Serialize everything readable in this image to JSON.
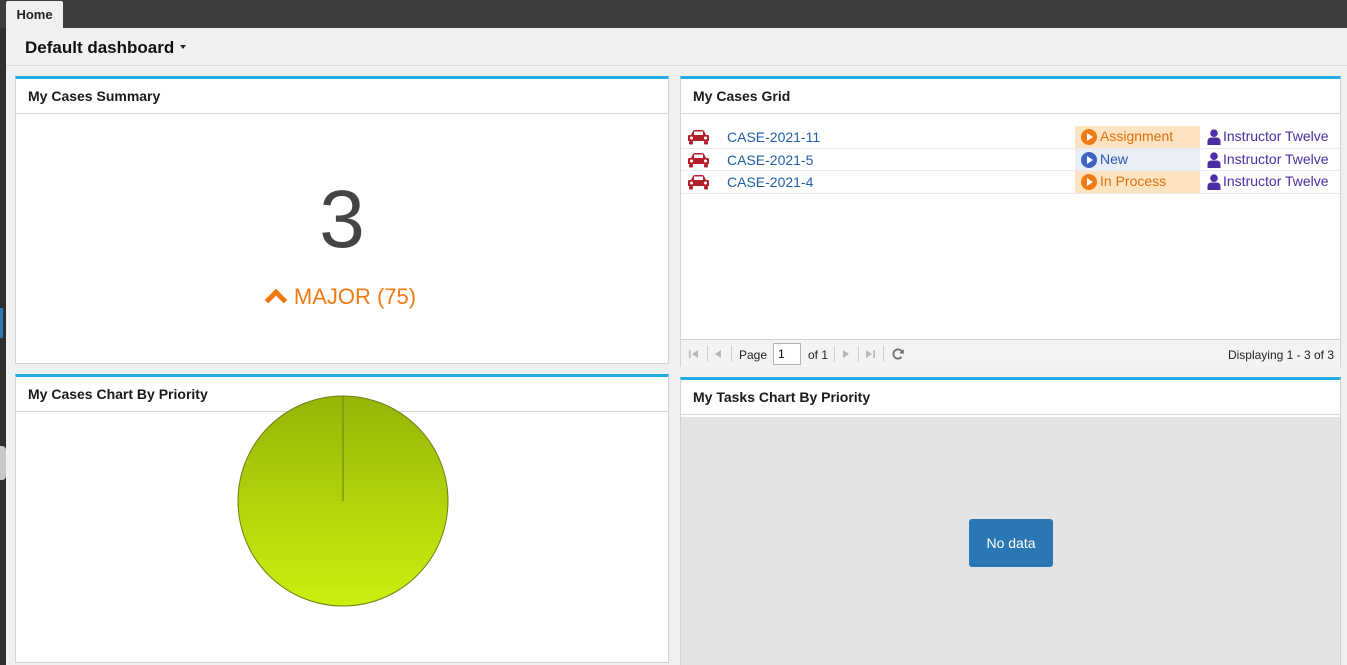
{
  "tabs": {
    "home": "Home"
  },
  "dashboard": {
    "title": "Default dashboard"
  },
  "summary": {
    "title": "My Cases Summary",
    "count": "3",
    "priority": "MAJOR (75)",
    "priority_color": "#f07a14"
  },
  "grid": {
    "title": "My Cases Grid",
    "rows": [
      {
        "icon": "car-icon",
        "case": "CASE-2021-11",
        "status": "Assignment",
        "status_style": "orange",
        "user": "Instructor Twelve"
      },
      {
        "icon": "car-icon",
        "case": "CASE-2021-5",
        "status": "New",
        "status_style": "blue",
        "user": "Instructor Twelve"
      },
      {
        "icon": "car-icon",
        "case": "CASE-2021-4",
        "status": "In Process",
        "status_style": "orange",
        "user": "Instructor Twelve"
      }
    ],
    "pager": {
      "page_label": "Page",
      "page_value": "1",
      "of_label": "of 1",
      "display_text": "Displaying 1 - 3 of 3"
    }
  },
  "cases_chart": {
    "title": "My Cases Chart By Priority"
  },
  "tasks_chart": {
    "title": "My Tasks Chart By Priority",
    "no_data": "No data"
  },
  "colors": {
    "accent": "#23ace6",
    "link": "#1f5fa7",
    "car": "#b3202c",
    "user": "#4b2ea3",
    "nodata_button": "#2a77b3"
  },
  "chart_data": {
    "type": "pie",
    "categories": [
      ""
    ],
    "values": [
      100
    ],
    "title": "",
    "colors": [
      "#b4d412"
    ]
  }
}
